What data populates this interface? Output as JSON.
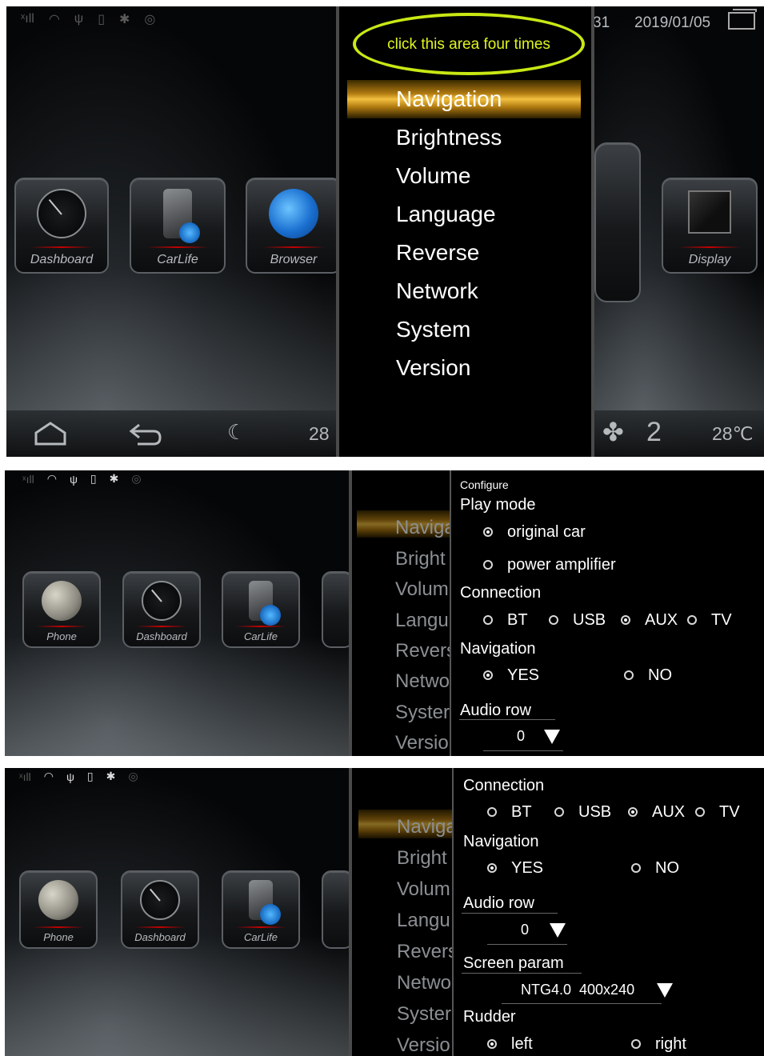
{
  "panel1": {
    "status_time": "31",
    "status_date": "2019/01/05",
    "annotation": "click this area four times",
    "menu": [
      "Navigation",
      "Brightness",
      "Volume",
      "Language",
      "Reverse",
      "Network",
      "System",
      "Version"
    ],
    "selected_menu": "Navigation",
    "tiles": [
      "Dashboard",
      "CarLife",
      "Browser",
      "Display"
    ],
    "bottom_temp_left": "28",
    "fan_level": "2",
    "bottom_temp_right": "28℃"
  },
  "panel2": {
    "tiles": [
      "Phone",
      "Dashboard",
      "CarLife"
    ],
    "menu_partial": [
      "Naviga",
      "Bright",
      "Volum",
      "Langu",
      "Revers",
      "Netwo",
      "Syster",
      "Versio"
    ],
    "config_title": "Configure",
    "play_mode_label": "Play mode",
    "play_mode_options": [
      "original car",
      "power amplifier"
    ],
    "connection_label": "Connection",
    "connection_options": [
      "BT",
      "USB",
      "AUX",
      "TV"
    ],
    "navigation_label": "Navigation",
    "navigation_options": [
      "YES",
      "NO"
    ],
    "audio_row_label": "Audio row",
    "audio_row_value": "0"
  },
  "panel3": {
    "tiles": [
      "Phone",
      "Dashboard",
      "CarLife"
    ],
    "menu_partial": [
      "Naviga",
      "Bright",
      "Volum",
      "Langu",
      "Revers",
      "Netwo",
      "Syster",
      "Versio"
    ],
    "connection_label": "Connection",
    "connection_options": [
      "BT",
      "USB",
      "AUX",
      "TV"
    ],
    "navigation_label": "Navigation",
    "navigation_options": [
      "YES",
      "NO"
    ],
    "audio_row_label": "Audio row",
    "audio_row_value": "0",
    "screen_param_label": "Screen param",
    "screen_param_value": "NTG4.0  400x240",
    "rudder_label": "Rudder",
    "rudder_options": [
      "left",
      "right"
    ]
  },
  "colors": {
    "annotation": "#dff51e",
    "selection_gold": "#f2c040",
    "background": "#000000"
  },
  "icons": {
    "status": [
      "signal-icon",
      "wifi-icon",
      "usb-icon",
      "sd-card-icon",
      "bluetooth-icon",
      "gps-icon"
    ],
    "bottom": [
      "home-icon",
      "back-icon",
      "night-mode-icon",
      "fan-icon"
    ]
  }
}
